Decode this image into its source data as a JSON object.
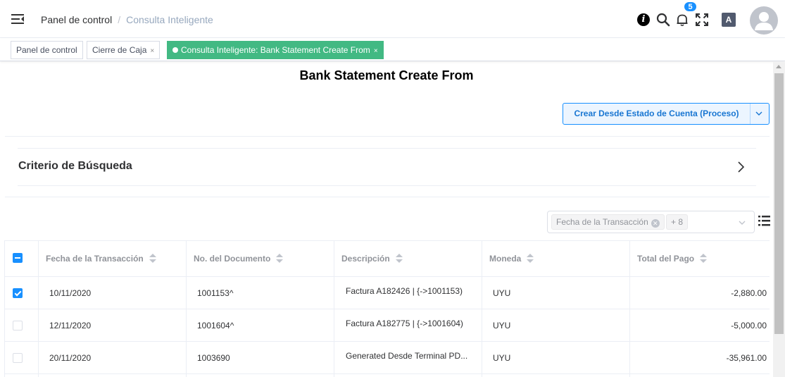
{
  "header": {
    "menu_icon": "hamburger-icon",
    "breadcrumb": {
      "first": "Panel de control",
      "separator": "/",
      "current": "Consulta Inteligente"
    },
    "icons": [
      "info-icon",
      "search-icon",
      "bell-icon",
      "fullscreen-icon",
      "translate-icon",
      "avatar-icon"
    ],
    "info_glyph": "i",
    "lang_glyph": "A",
    "notification_count": "5"
  },
  "tabs": [
    {
      "label": "Panel de control",
      "closable": false,
      "active": false
    },
    {
      "label": "Cierre de Caja",
      "close": "×",
      "active": false
    },
    {
      "label": "Consulta Inteligente: Bank Statement Create From",
      "close": "×",
      "active": true
    }
  ],
  "page": {
    "title": "Bank Statement Create From",
    "process_button": "Crear Desde Estado de Cuenta (Proceso)",
    "search_criteria": "Criterio de Búsqueda"
  },
  "column_selector": {
    "selected_chip": "Fecha de la Transacción",
    "more_chip": "+ 8"
  },
  "table": {
    "columns": [
      "Fecha de la Transacción",
      "No. del Documento",
      "Descripción",
      "Moneda",
      "Total del Pago"
    ],
    "rows": [
      {
        "checked": true,
        "date": "10/11/2020",
        "document": "1001153^",
        "description": "Factura A182426 | {->1001153)",
        "currency": "UYU",
        "total": "-2,880.00"
      },
      {
        "checked": false,
        "date": "12/11/2020",
        "document": "1001604^",
        "description": "Factura A182775 | {->1001604)",
        "currency": "UYU",
        "total": "-5,000.00"
      },
      {
        "checked": false,
        "date": "20/11/2020",
        "document": "1003690",
        "description": "Generated Desde Terminal PD...",
        "currency": "UYU",
        "total": "-35,961.00"
      }
    ]
  },
  "colors": {
    "accent": "#1890ff",
    "active_tab": "#42b983",
    "border": "#ebeef5"
  }
}
